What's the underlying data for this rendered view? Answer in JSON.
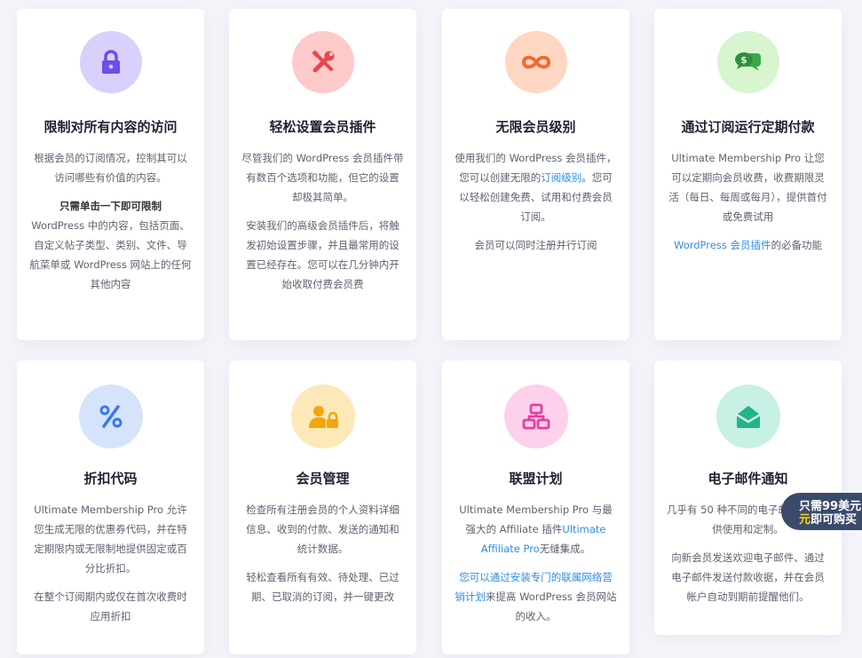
{
  "colors": {
    "lock": "#d9d0fb",
    "tools": "#fecaca",
    "infinity": "#fed7c3",
    "chat": "#d7f5cf",
    "percent": "#d5e3fb",
    "user": "#fde8b8",
    "network": "#fdd0ec",
    "mail": "#c6f1e4"
  },
  "cards": [
    {
      "icon": "lock-icon",
      "title": "限制对所有内容的访问",
      "p1": "根据会员的订阅情况，控制其可以访问哪些有价值的内容。",
      "p2_bold": "只需单击一下即可限制",
      "p2_rest": "WordPress 中的内容，包括页面、自定义帖子类型、类别、文件、导航菜单或 WordPress 网站上的任何其他内容"
    },
    {
      "icon": "tools-icon",
      "title": "轻松设置会员插件",
      "p1": "尽管我们的 WordPress 会员插件带有数百个选项和功能，但它的设置却极其简单。",
      "p2": "安装我们的高级会员插件后，将触发初始设置步骤，并且最常用的设置已经存在。您可以在几分钟内开始收取付费会员费"
    },
    {
      "icon": "infinity-icon",
      "title": "无限会员级别",
      "p1_a": "使用我们的 WordPress 会员插件，您可以创建无限的",
      "p1_link": "订阅级别",
      "p1_b": "。您可以轻松创建免费、试用和付费会员订阅。",
      "p2": "会员可以同时注册并行订阅"
    },
    {
      "icon": "chat-dollar-icon",
      "title": "通过订阅运行定期付款",
      "p1": "Ultimate Membership Pro 让您可以定期向会员收费，收费期限灵活（每日、每周或每月），提供首付或免费试用",
      "p2_link": "WordPress 会员插件",
      "p2_rest": "的必备功能"
    },
    {
      "icon": "percent-icon",
      "title": "折扣代码",
      "p1": "Ultimate Membership Pro 允许您生成无限的优惠券代码，并在特定期限内或无限制地提供固定或百分比折扣。",
      "p2": "在整个订阅期内或仅在首次收费时应用折扣"
    },
    {
      "icon": "user-lock-icon",
      "title": "会员管理",
      "p1": "检查所有注册会员的个人资料详细信息、收到的付款、发送的通知和统计数据。",
      "p2": "轻松查看所有有效、待处理、已过期、已取消的订阅，并一键更改"
    },
    {
      "icon": "network-icon",
      "title": "联盟计划",
      "p1_a": "Ultimate Membership Pro 与最强大的 Affiliate 插件",
      "p1_link": "Ultimate Affiliate Pro",
      "p1_b": "无缝集成。",
      "p2_link": "您可以通过安装专门的联属网络营销计划",
      "p2_rest": "来提高 WordPress 会员网站的收入。"
    },
    {
      "icon": "envelope-icon",
      "title": "电子邮件通知",
      "p1": "几乎有 50 种不同的电子邮件模板可供使用和定制。",
      "p2": "向新会员发送欢迎电子邮件、通过电子邮件发送付款收据，并在会员帐户自动到期前提醒他们。"
    }
  ],
  "promo": {
    "line1": "只需99美元",
    "line2_hl": "元",
    "line2_rest": "即可购买"
  }
}
